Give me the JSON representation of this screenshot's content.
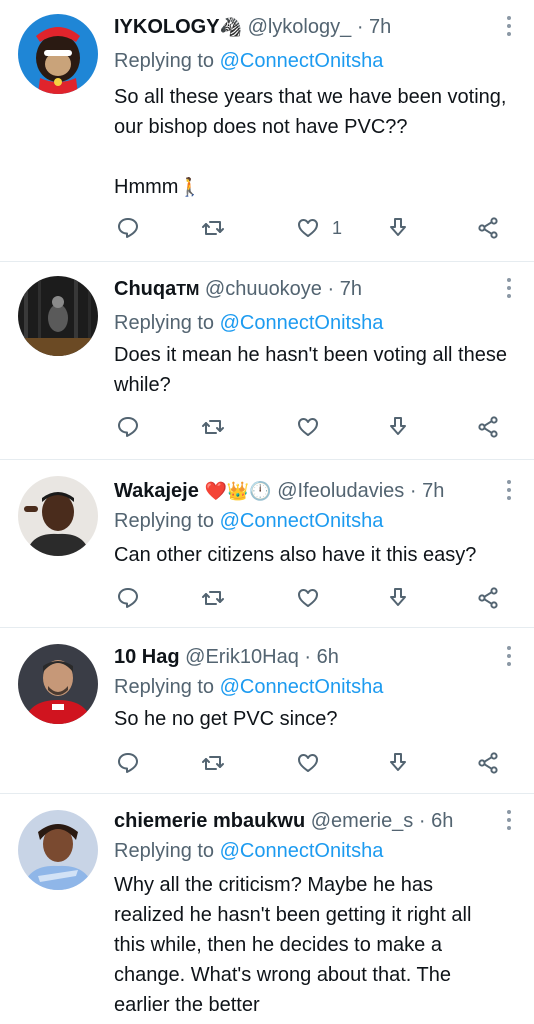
{
  "tweets": [
    {
      "name": "IYKOLOGY",
      "name_emoji": "🦓",
      "handle": "@lykology_",
      "sep": "·",
      "time": "7h",
      "replying_prefix": "Replying to",
      "replying_to": "@ConnectOnitsha",
      "text_lines": [
        "So all these years that we have been voting, our bishop does not have PVC??"
      ],
      "text_extra": "Hmmm",
      "text_extra_emoji": "🚶",
      "like_count": "1"
    },
    {
      "name": "Chuqa",
      "name_badge": "TM",
      "handle": "@chuuokoye",
      "sep": "·",
      "time": "7h",
      "replying_prefix": "Replying to",
      "replying_to": "@ConnectOnitsha",
      "text": "Does it mean he hasn't been voting all these while?"
    },
    {
      "name": "Wakajeje",
      "name_emoji": "❤️👑🕛",
      "handle": "@Ifeoludavies",
      "sep": "·",
      "time": "7h",
      "replying_prefix": "Replying to",
      "replying_to": "@ConnectOnitsha",
      "text": "Can other citizens also have it this easy?"
    },
    {
      "name": "10 Hag",
      "handle": "@Erik10Haq",
      "sep": "·",
      "time": "6h",
      "replying_prefix": "Replying to",
      "replying_to": "@ConnectOnitsha",
      "text": "So he no get PVC since?"
    },
    {
      "name": "chiemerie mbaukwu",
      "handle": "@emerie_s",
      "sep": "·",
      "time": "6h",
      "replying_prefix": "Replying to",
      "replying_to": "@ConnectOnitsha",
      "text": "Why all the criticism? Maybe he has realized he hasn't been getting it right all this while, then he decides to make a change. What's wrong about that. The earlier the better"
    }
  ],
  "colors": {
    "text": "#0f1419",
    "secondary": "#536471",
    "link": "#1d9bf0",
    "divider": "#e6ecf0"
  },
  "icons": [
    "reply-icon",
    "retweet-icon",
    "like-icon",
    "download-icon",
    "share-icon",
    "more-icon"
  ]
}
